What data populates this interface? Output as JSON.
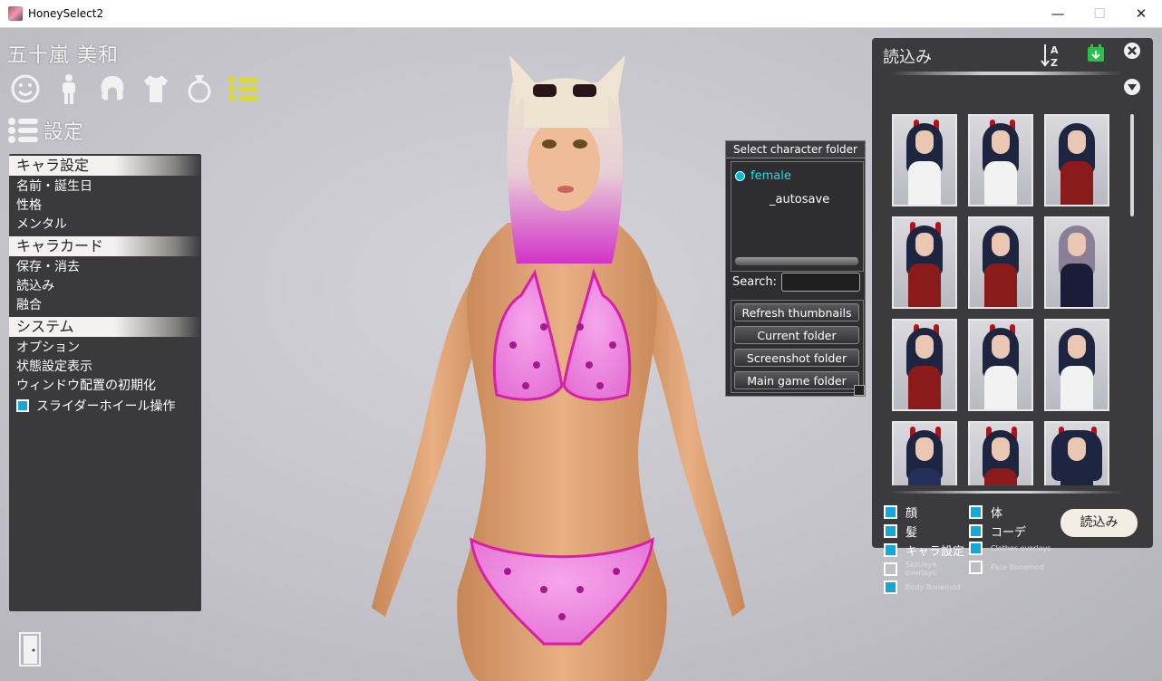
{
  "window": {
    "title": "HoneySelect2",
    "minimize": "—",
    "maximize": "☐",
    "close": "✕"
  },
  "character": {
    "name": "五十嵐 美和"
  },
  "left_panel": {
    "category_icons": [
      "face-icon",
      "body-icon",
      "hair-icon",
      "clothes-icon",
      "accessory-icon",
      "settings-list-icon"
    ],
    "settings_label": "設定",
    "sections": [
      {
        "title": "キャラ設定",
        "items": [
          "名前・誕生日",
          "性格",
          "メンタル"
        ]
      },
      {
        "title": "キャラカード",
        "items": [
          "保存・消去",
          "読込み",
          "融合"
        ]
      },
      {
        "title": "システム",
        "items": [
          "オプション",
          "状態設定表示",
          "ウィンドウ配置の初期化"
        ]
      }
    ],
    "slider_wheel_label": "スライダーホイール操作",
    "slider_wheel_checked": true
  },
  "folder_dialog": {
    "title": "Select character folder",
    "nodes": [
      "female",
      "_autosave"
    ],
    "search_label": "Search:",
    "search_value": "",
    "buttons": [
      "Refresh thumbnails",
      "Current folder",
      "Screenshot folder",
      "Main game folder"
    ]
  },
  "load_panel": {
    "title": "読込み",
    "load_button": "読込み",
    "options": [
      {
        "label": "顔",
        "checked": true
      },
      {
        "label": "体",
        "checked": true
      },
      {
        "label": "髪",
        "checked": true
      },
      {
        "label": "コーデ",
        "checked": true
      },
      {
        "label": "キャラ設定",
        "checked": true
      },
      {
        "label": "Clothes overlays",
        "checked": true
      },
      {
        "label": "Skin/eye overlays",
        "checked": false
      },
      {
        "label": "Face Bonemod",
        "checked": false
      },
      {
        "label": "Body Bonemod",
        "checked": true
      }
    ],
    "thumbnail_count": 12
  },
  "colors": {
    "checkbox": "#12a8d8",
    "accent_yellow": "#d8d83a",
    "active_folder": "#18e0ee",
    "panel_bg": "#3b3b3e"
  }
}
